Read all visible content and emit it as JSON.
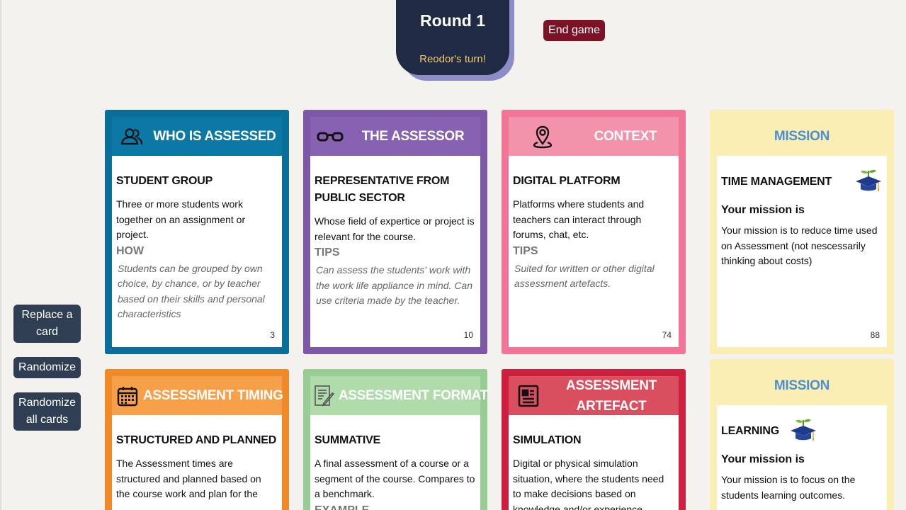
{
  "header": {
    "round_title": "Round 1",
    "turn_text": "Reodor's turn!",
    "end_game": "End game"
  },
  "side": {
    "replace": "Replace a card",
    "randomize": "Randomize",
    "randomize_all": "Randomize all cards"
  },
  "cards": [
    {
      "category": "WHO IS ASSESSED",
      "icon": "people-icon",
      "name": "STUDENT GROUP",
      "description": "Three or more students work together on an assignment or project.",
      "sub_label": "HOW",
      "sub_text": "Students can be grouped by own choice, by chance, or by teacher based on their skills and personal characteristics",
      "number": "3"
    },
    {
      "category": "THE ASSESSOR",
      "icon": "glasses-icon",
      "name": "REPRESENTATIVE FROM PUBLIC SECTOR",
      "description": "Whose field of expertice or project is relevant for the course.",
      "sub_label": "TIPS",
      "sub_text": "Can assess the students' work with the work life appliance in mind. Can use criteria made by the teacher.",
      "number": "10"
    },
    {
      "category": "CONTEXT",
      "icon": "location-pin-icon",
      "name": "DIGITAL PLATFORM",
      "description": "Platforms where students and teachers can interact through forums, chat, etc.",
      "sub_label": "TIPS",
      "sub_text": "Suited for written or other digital assessment artefacts.",
      "number": "74"
    },
    {
      "category": "MISSION",
      "icon": "graduation-cap-plant-icon",
      "name": "TIME MANAGEMENT",
      "your_mission": "Your mission is",
      "description": "Your mission is to reduce time used on Assessment (not nescessarily thinking about costs)",
      "number": "88"
    },
    {
      "category": "ASSESSMENT TIMING",
      "icon": "calendar-icon",
      "name": "STRUCTURED AND PLANNED",
      "description": "The Assessment times are structured and planned based on the course work and plan for the"
    },
    {
      "category": "ASSESSMENT FORMAT",
      "icon": "document-pen-icon",
      "name": "SUMMATIVE",
      "description": "A final assessment of a course or a segment of the course. Compares to a benchmark.",
      "sub_label": "EXAMPLE"
    },
    {
      "category": "ASSESSMENT ARTEFACT",
      "icon": "newspaper-icon",
      "name": "SIMULATION",
      "description": "Digital or physical simulation situation, where the students need to make decisions based on knowledge and/or experience"
    },
    {
      "category": "MISSION",
      "icon": "graduation-cap-plant-icon",
      "name": "LEARNING",
      "your_mission": "Your mission is",
      "description": "Your mission is to focus on the students learning outcomes."
    }
  ],
  "colors": {
    "background": "#f4f2ee",
    "round_badge": "#1f2a44",
    "turn_text": "#f5c86a",
    "end_game": "#7c1225",
    "side_buttons": "#2f3e52",
    "who_is_assessed": "#0b6e98",
    "the_assessor": "#7c58a6",
    "context": "#f27496",
    "mission": "#fbeeb4",
    "assessment_timing": "#f08a28",
    "assessment_format": "#97cd94",
    "assessment_artefact": "#cf1f3e"
  }
}
